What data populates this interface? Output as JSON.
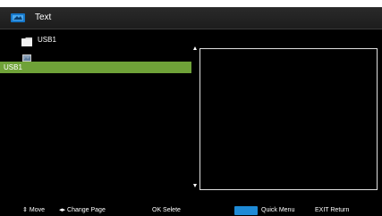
{
  "window": {
    "title": "Text"
  },
  "file_list": {
    "folder": {
      "label": "USB1",
      "icon": "folder-icon"
    },
    "file": {
      "icon": "file-icon"
    },
    "selected_item": {
      "label": "USB1"
    }
  },
  "footer": {
    "move": {
      "icon": "up-down-arrows-icon",
      "glyph": "⇕",
      "label": "Move"
    },
    "change_page": {
      "icon": "left-right-arrows-icon",
      "glyph": "◂▸",
      "label": "Change Page"
    },
    "ok": {
      "label": "OK  Selete"
    },
    "quick_menu": {
      "icon": "blue-key-icon",
      "color": "#1e8ad6",
      "label": "Quick Menu"
    },
    "exit": {
      "label": "EXIT  Return"
    }
  },
  "colors": {
    "background": "#000000",
    "selection": "#6fa238",
    "title_bar": "#222222",
    "preview_border": "#e0e0e0"
  }
}
